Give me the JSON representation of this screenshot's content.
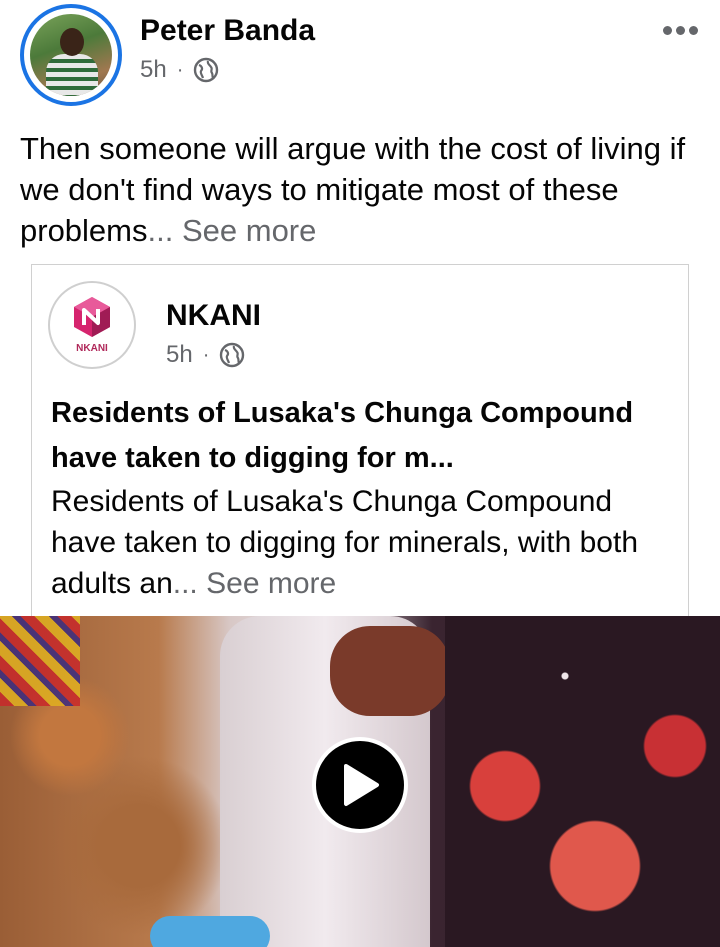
{
  "post": {
    "author": "Peter Banda",
    "time": "5h",
    "separator": "·",
    "privacy_icon": "globe-icon",
    "text": "Then someone will argue with the cost of living if we don't find ways to mitigate most of these problems",
    "ellipsis": "...",
    "see_more": "See more"
  },
  "shared": {
    "page_name": "NKANI",
    "logo_text": "NKANI",
    "time": "5h",
    "separator": "·",
    "headline": "Residents of Lusaka's Chunga Compound have taken to digging for m...",
    "excerpt": "Residents of Lusaka's Chunga Compound have taken to digging for minerals, with both adults an",
    "ellipsis": "...",
    "see_more": "See more"
  },
  "video": {
    "play_icon": "play-icon"
  },
  "colors": {
    "accent": "#1b74e4",
    "secondary_text": "#65676b",
    "brand": "#d6246e"
  }
}
